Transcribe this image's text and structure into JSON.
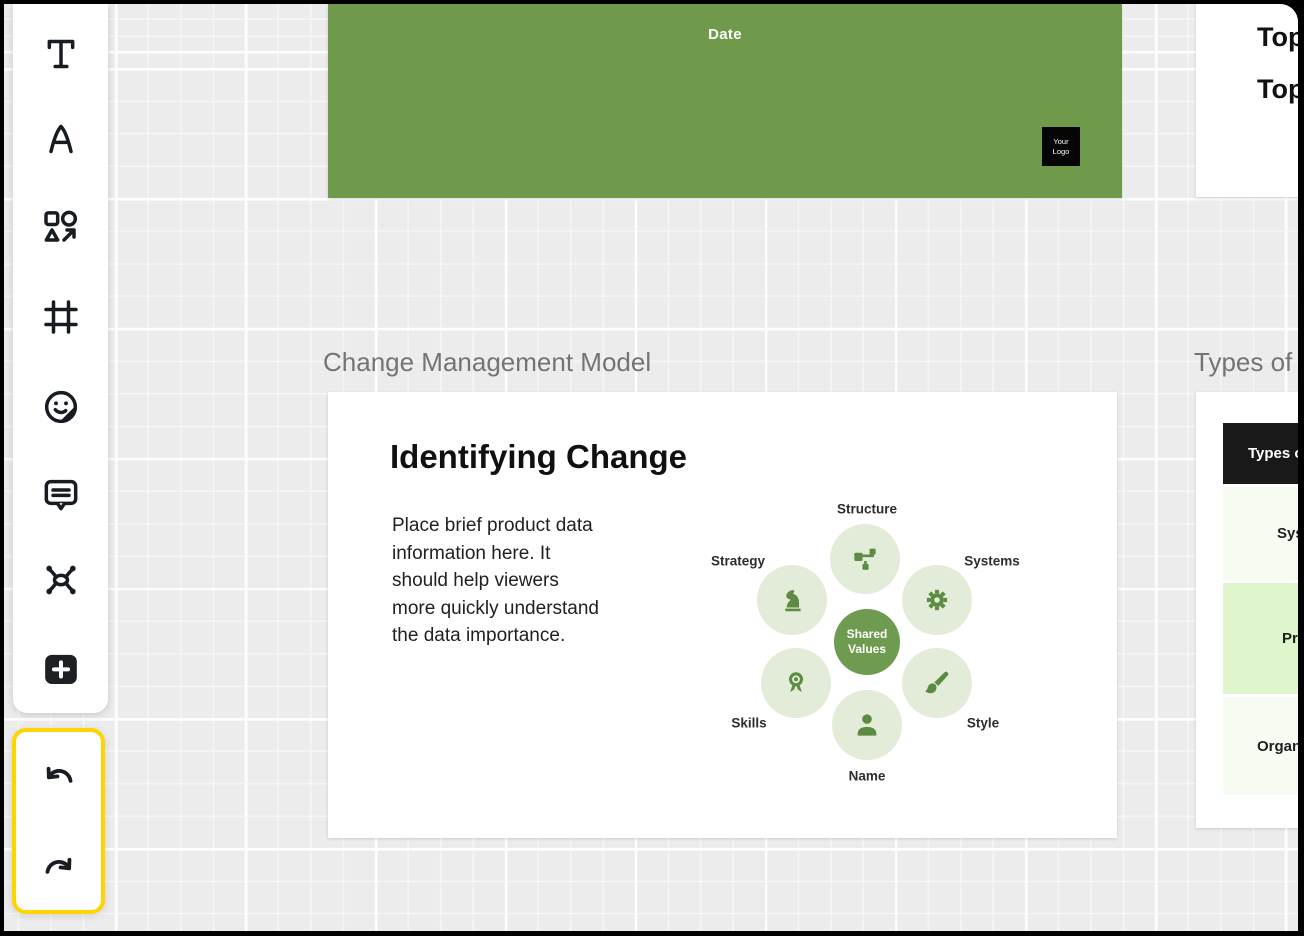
{
  "app": {
    "name": "whiteboard-presentation-editor"
  },
  "colors": {
    "canvas_bg": "#ececec",
    "slide_green": "#6f9a4b",
    "diagram_circle_light": "#e3ecd9",
    "diagram_circle_dark": "#6f9b50",
    "diagram_icon_green": "#5d8b43",
    "table_header": "#191919",
    "table_row_light": "#f7fcf2",
    "table_row_green": "#dff5cb",
    "history_highlight": "#ffd400",
    "frame_label": "#747474"
  },
  "toolbar": {
    "tools": [
      {
        "name": "text-tool"
      },
      {
        "name": "font-tool"
      },
      {
        "name": "shapes-tool"
      },
      {
        "name": "frame-tool"
      },
      {
        "name": "sticker-tool"
      },
      {
        "name": "comment-tool"
      },
      {
        "name": "connector-tool"
      },
      {
        "name": "add-tool"
      }
    ]
  },
  "history": {
    "buttons": [
      "undo",
      "redo"
    ]
  },
  "frames": [
    {
      "label": "Change Management Model"
    },
    {
      "label": "Types of"
    }
  ],
  "date_slide": {
    "title": "Date",
    "logo": "Your\nLogo"
  },
  "topics_card": {
    "lines": [
      "Top",
      "Top"
    ]
  },
  "change_slide": {
    "heading": "Identifying Change",
    "body": "Place brief product data\ninformation here. It\nshould help viewers\nmore quickly understand\nthe data importance.",
    "diagram": {
      "center_label": "Shared\nValues",
      "items": [
        {
          "label": "Structure",
          "icon": "sitemap-icon"
        },
        {
          "label": "Systems",
          "icon": "gear-icon"
        },
        {
          "label": "Style",
          "icon": "paintbrush-icon"
        },
        {
          "label": "Name",
          "icon": "person-icon"
        },
        {
          "label": "Skills",
          "icon": "award-icon"
        },
        {
          "label": "Strategy",
          "icon": "knight-icon"
        }
      ]
    }
  },
  "types_slide": {
    "header": "Types of",
    "rows": [
      {
        "label": "Sys"
      },
      {
        "label": "Pr"
      },
      {
        "label": "Organ"
      }
    ]
  }
}
